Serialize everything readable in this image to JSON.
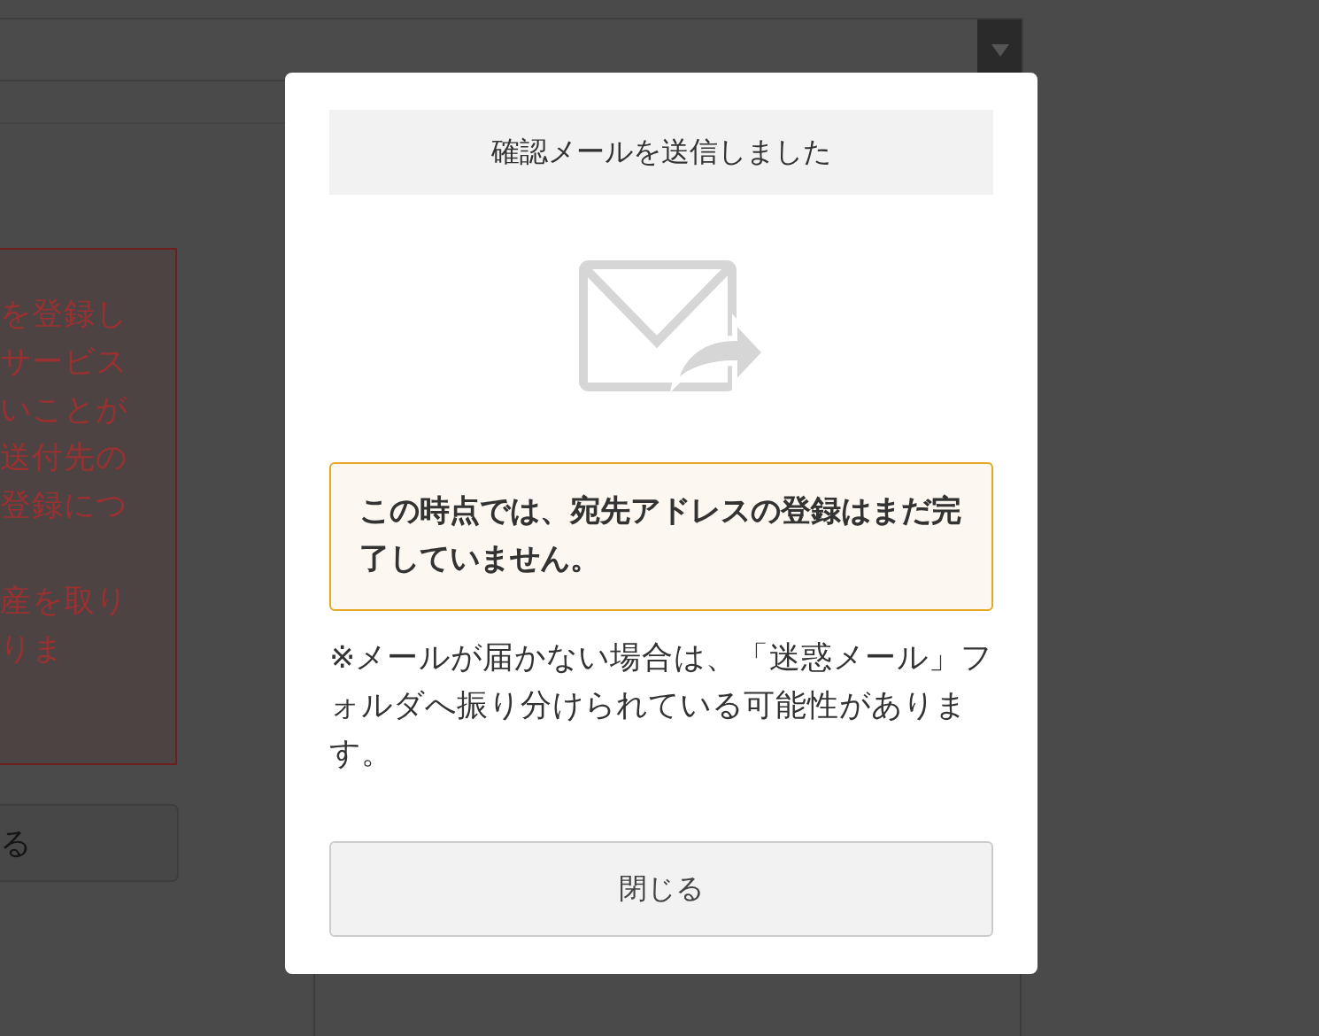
{
  "background": {
    "notice_paragraphs": [
      [
        "を登録し",
        "サービス",
        "いことが",
        "送付先の",
        "登録につ"
      ],
      [
        "産を取り",
        "りま"
      ]
    ],
    "button": "る"
  },
  "dialog": {
    "title": "確認メールを送信しました",
    "alert": "この時点では、宛先アドレスの登録はまだ完了していません。",
    "note": "※メールが届かない場合は、「迷惑メール」フォルダへ振り分けられている可能性があります。",
    "close_button": "閉じる"
  }
}
